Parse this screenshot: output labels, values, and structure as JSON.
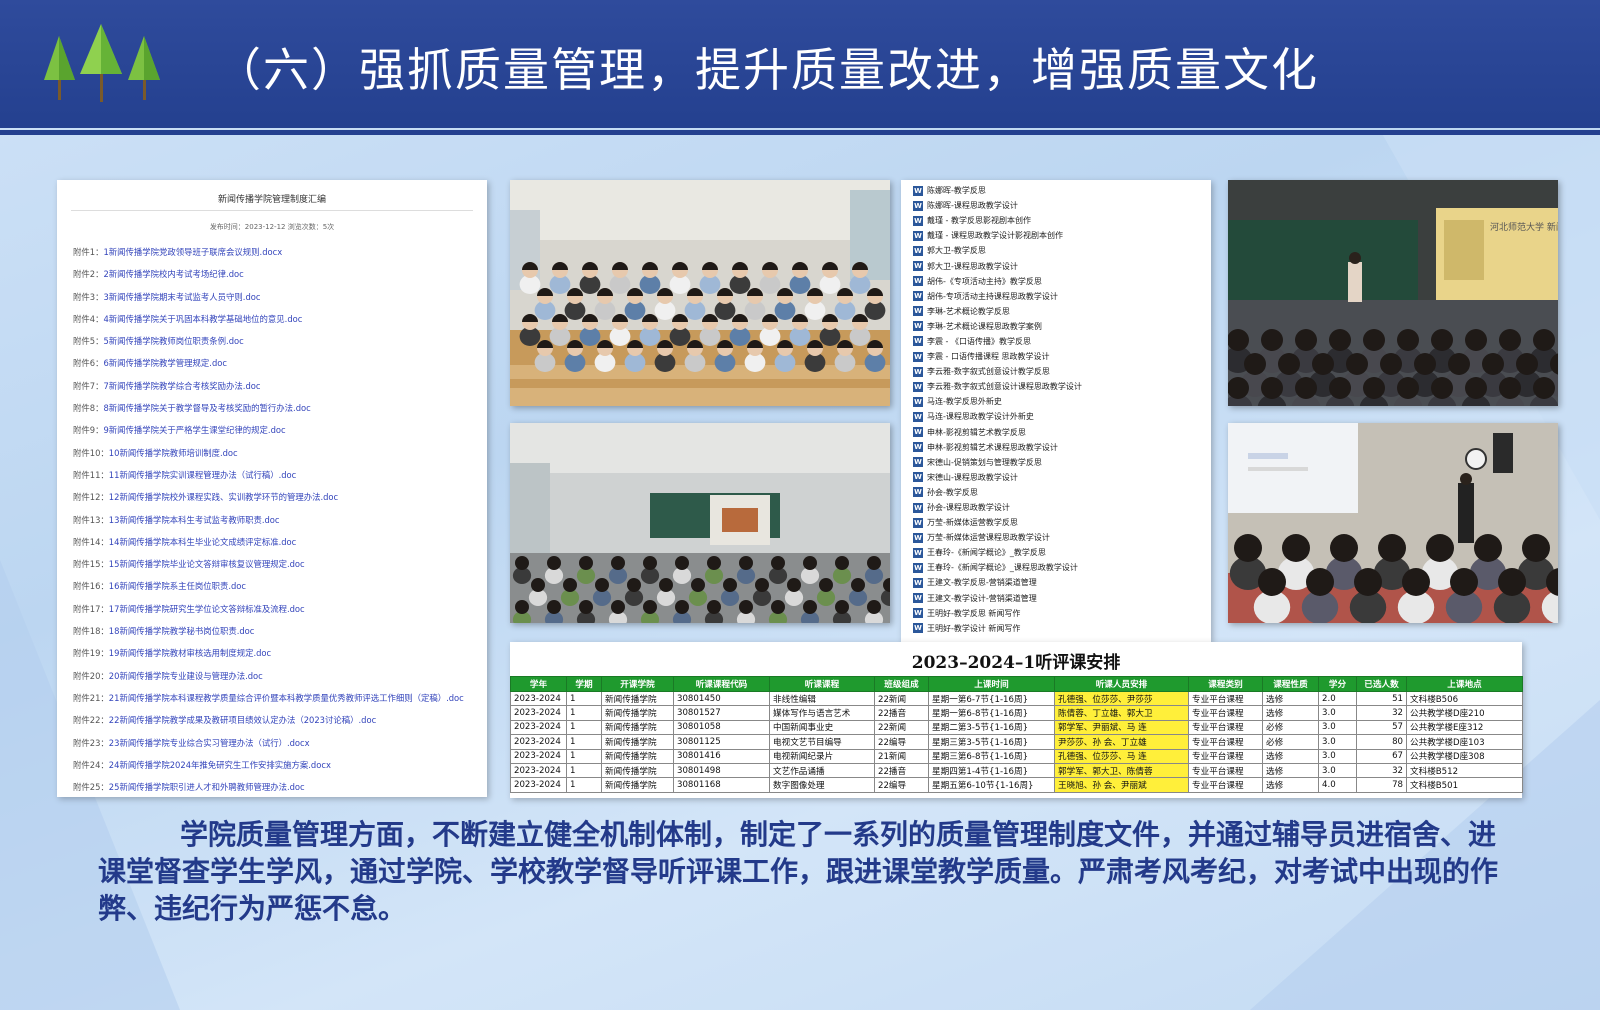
{
  "header": {
    "title": "（六）强抓质量管理，提升质量改进，增强质量文化"
  },
  "colors": {
    "header_bg": "#2f4b9c",
    "body_text": "#233a8a",
    "table_header": "#1f9a2e",
    "highlight": "#ffef3a",
    "link": "#3344bb"
  },
  "doc_panel": {
    "title": "新闻传播学院管理制度汇编",
    "meta": "发布时间：2023-12-12 浏览次数：5次",
    "items": [
      {
        "prefix": "附件1：",
        "text": "1新闻传播学院党政领导班子联席会议规则.docx"
      },
      {
        "prefix": "附件2：",
        "text": "2新闻传播学院校内考试考场纪律.doc"
      },
      {
        "prefix": "附件3：",
        "text": "3新闻传播学院期末考试监考人员守则.doc"
      },
      {
        "prefix": "附件4：",
        "text": "4新闻传播学院关于巩固本科教学基础地位的意见.doc"
      },
      {
        "prefix": "附件5：",
        "text": "5新闻传播学院教师岗位职责条例.doc"
      },
      {
        "prefix": "附件6：",
        "text": "6新闻传播学院教学管理规定.doc"
      },
      {
        "prefix": "附件7：",
        "text": "7新闻传播学院教学综合考核奖励办法.doc"
      },
      {
        "prefix": "附件8：",
        "text": "8新闻传播学院关于教学督导及考核奖励的暂行办法.doc"
      },
      {
        "prefix": "附件9：",
        "text": "9新闻传播学院关于严格学生课堂纪律的规定.doc"
      },
      {
        "prefix": "附件10：",
        "text": "10新闻传播学院教师培训制度.doc"
      },
      {
        "prefix": "附件11：",
        "text": "11新闻传播学院实训课程管理办法（试行稿）.doc"
      },
      {
        "prefix": "附件12：",
        "text": "12新闻传播学院校外课程实践、实训教学环节的管理办法.doc"
      },
      {
        "prefix": "附件13：",
        "text": "13新闻传播学院本科生考试监考教师职责.doc"
      },
      {
        "prefix": "附件14：",
        "text": "14新闻传播学院本科生毕业论文成绩评定标准.doc"
      },
      {
        "prefix": "附件15：",
        "text": "15新闻传播学院毕业论文答辩审核复议管理规定.doc"
      },
      {
        "prefix": "附件16：",
        "text": "16新闻传播学院系主任岗位职责.doc"
      },
      {
        "prefix": "附件17：",
        "text": "17新闻传播学院研究生学位论文答辩标准及流程.doc"
      },
      {
        "prefix": "附件18：",
        "text": "18新闻传播学院教学秘书岗位职责.doc"
      },
      {
        "prefix": "附件19：",
        "text": "19新闻传播学院教材审核选用制度规定.doc"
      },
      {
        "prefix": "附件20：",
        "text": "20新闻传播学院专业建设与管理办法.doc"
      },
      {
        "prefix": "附件21：",
        "text": "21新闻传播学院本科课程教学质量综合评价暨本科教学质量优秀教师评选工作细则（定稿）.doc"
      },
      {
        "prefix": "附件22：",
        "text": "22新闻传播学院教学成果及教研项目绩效认定办法（2023讨论稿）.doc"
      },
      {
        "prefix": "附件23：",
        "text": "23新闻传播学院专业综合实习管理办法（试行）.docx"
      },
      {
        "prefix": "附件24：",
        "text": "24新闻传播学院2024年推免研究生工作安排实施方案.docx"
      },
      {
        "prefix": "附件25：",
        "text": "25新闻传播学院职引进人才和外聘教师管理办法.doc"
      }
    ]
  },
  "word_files": [
    "陈娜晖-教学反思",
    "陈娜晖-课程思政教学设计",
    "戴瑾 - 教学反思影视剧本创作",
    "戴瑾 - 课程思政教学设计影视剧本创作",
    "郭大卫-教学反思",
    "郭大卫-课程思政教学设计",
    "胡伟-《专项活动主持》教学反思",
    "胡伟-专项活动主持课程思政教学设计",
    "李琳-艺术概论教学反思",
    "李琳-艺术概论课程思政教学案例",
    "李震 - 《口语传播》教学反思",
    "李震 - 口语传播课程  思政教学设计",
    "李云雅-数字叙式创意设计教学反思",
    "李云雅-数字叙式创意设计课程思政教学设计",
    "马连-教学反思外新史",
    "马连-课程思政教学设计外新史",
    "申林-影视剪辑艺术教学反思",
    "申林-影视剪辑艺术课程思政教学设计",
    "宋德山-促销策划与管理教学反思",
    "宋德山-课程思政教学设计",
    "孙会-教学反思",
    "孙会-课程思政教学设计",
    "万莹-新媒体运营教学反思",
    "万莹-新媒体运营课程思政教学设计",
    "王春玲-《新闻学概论》_教学反思",
    "王春玲-《新闻学概论》_课程思政教学设计",
    "王建文-教学反思-营销渠道管理",
    "王建文-教学设计-营销渠道管理",
    "王明好-教学反思 新闻写作",
    "王明好-教学设计 新闻写作"
  ],
  "schedule": {
    "title": "2023–2024–1听评课安排",
    "headers": [
      "学年",
      "学期",
      "开课学院",
      "听课课程代码",
      "听课课程",
      "班级组成",
      "上课时间",
      "听课人员安排",
      "课程类别",
      "课程性质",
      "学分",
      "已选人数",
      "上课地点"
    ],
    "rows": [
      [
        "2023-2024",
        "1",
        "新闻传播学院",
        "30801450",
        "非线性编辑",
        "22新闻",
        "星期一第6-7节{1-16周}",
        "孔德强、位莎莎、尹莎莎",
        "专业平台课程",
        "选修",
        "2.0",
        "51",
        "文科楼B506"
      ],
      [
        "2023-2024",
        "1",
        "新闻传播学院",
        "30801527",
        "媒体写作与语言艺术",
        "22播音",
        "星期一第6-8节{1-16周}",
        "陈倩蓉、丁立雄、郭大卫",
        "专业平台课程",
        "选修",
        "3.0",
        "32",
        "公共教学楼D座210"
      ],
      [
        "2023-2024",
        "1",
        "新闻传播学院",
        "30801058",
        "中国新闻事业史",
        "22新闻",
        "星期二第3-5节{1-16周}",
        "郭学军、尹丽斌、马  连",
        "专业平台课程",
        "必修",
        "3.0",
        "57",
        "公共教学楼E座312"
      ],
      [
        "2023-2024",
        "1",
        "新闻传播学院",
        "30801125",
        "电视文艺节目编导",
        "22编导",
        "星期三第3-5节{1-16周}",
        "尹莎莎、孙  会、丁立雄",
        "专业平台课程",
        "必修",
        "3.0",
        "80",
        "公共教学楼D座103"
      ],
      [
        "2023-2024",
        "1",
        "新闻传播学院",
        "30801416",
        "电视新闻纪录片",
        "21新闻",
        "星期三第6-8节{1-16周}",
        "孔德强、位莎莎、马  连",
        "专业平台课程",
        "选修",
        "3.0",
        "67",
        "公共教学楼D座308"
      ],
      [
        "2023-2024",
        "1",
        "新闻传播学院",
        "30801498",
        "文艺作品诵播",
        "22播音",
        "星期四第1-4节{1-16周}",
        "郭学军、郭大卫、陈倩蓉",
        "专业平台课程",
        "选修",
        "3.0",
        "32",
        "文科楼B512"
      ],
      [
        "2023-2024",
        "1",
        "新闻传播学院",
        "30801168",
        "数字图像处理",
        "22编导",
        "星期五第6-10节{1-16周}",
        "王晓旭、孙  会、尹丽斌",
        "专业平台课程",
        "选修",
        "4.0",
        "78",
        "文科楼B501"
      ]
    ]
  },
  "photos": {
    "classroom_group": "classroom-group-photo",
    "lecture_hall": "lecture-hall-photo",
    "teacher_lecture": "teacher-lecture-photo",
    "student_presentation": "student-presentation-photo",
    "slide_caption": "河北师范大学 新闻传播学院"
  },
  "body_text": "学院质量管理方面，不断建立健全机制体制，制定了一系列的质量管理制度文件，并通过辅导员进宿舍、进课堂督查学生学风，通过学院、学校教学督导听评课工作，跟进课堂教学质量。严肃考风考纪，对考试中出现的作弊、违纪行为严惩不怠。"
}
